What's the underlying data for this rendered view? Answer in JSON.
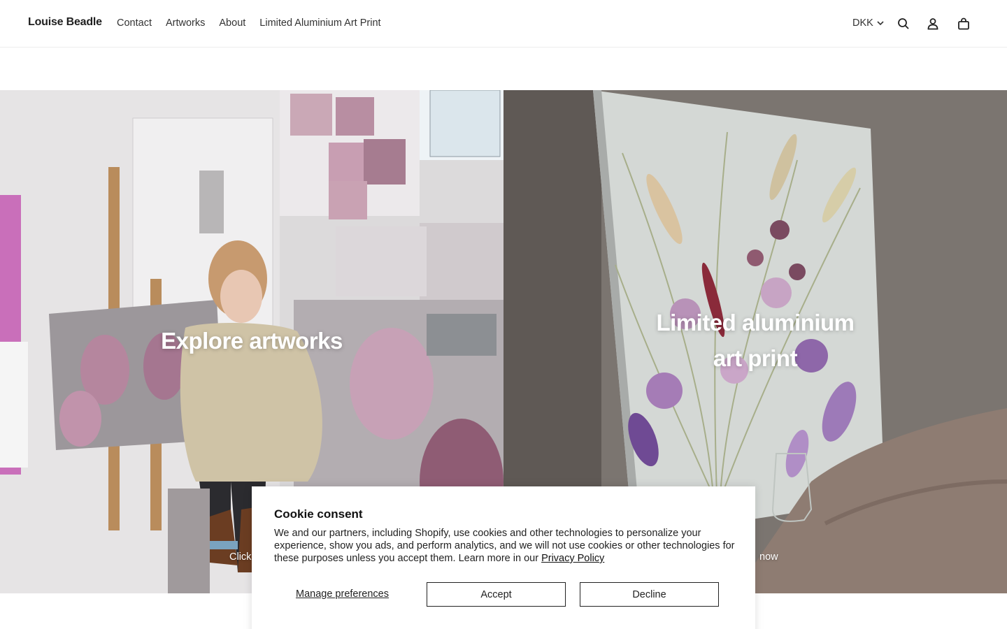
{
  "header": {
    "brand": "Louise Beadle",
    "nav": [
      "Contact",
      "Artworks",
      "About",
      "Limited Aluminium Art Print"
    ],
    "currency": "DKK",
    "icons": [
      "search-icon",
      "account-icon",
      "cart-icon"
    ]
  },
  "hero": {
    "left": {
      "title": "Explore artworks",
      "sub": "Click"
    },
    "right": {
      "title_line1": "Limited aluminium",
      "title_line2": "art print",
      "sub": "now"
    }
  },
  "cookie": {
    "title": "Cookie consent",
    "text": "We and our partners, including Shopify, use cookies and other technologies to personalize your experience, show you ads, and perform analytics, and we will not use cookies or other technologies for these purposes unless you accept them. Learn more in our ",
    "link": "Privacy Policy",
    "manage": "Manage preferences",
    "accept": "Accept",
    "decline": "Decline"
  },
  "colors": {
    "text": "#222222",
    "white": "#ffffff",
    "border": "#222222"
  }
}
